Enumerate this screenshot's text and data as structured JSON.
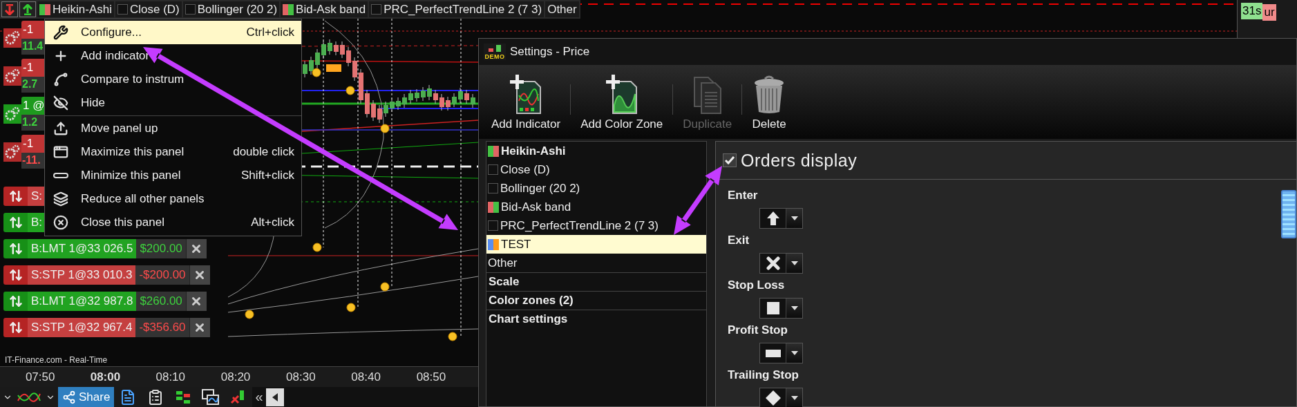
{
  "tabs": [
    {
      "label": "Heikin-Ashi",
      "kind": "indicator",
      "colors": [
        {
          "color": "#44c044"
        },
        {
          "color": "#e06464"
        }
      ]
    },
    {
      "label": "Close (D)",
      "kind": "indicator"
    },
    {
      "label": "Bollinger (20 2)",
      "kind": "indicator"
    },
    {
      "label": "Bid-Ask band",
      "kind": "indicator",
      "colors": [
        {
          "color": "#e06464"
        },
        {
          "color": "#44c044"
        }
      ]
    },
    {
      "label": "PRC_PerfectTrendLine 2 (7 3)",
      "kind": "indicator"
    },
    {
      "label": "Other",
      "kind": "plain"
    }
  ],
  "price_axis": {
    "timer": "31s",
    "badge": "ur"
  },
  "positions": [
    {
      "kind": "sell",
      "label": "-1",
      "value": "11.4",
      "gain": true
    },
    {
      "kind": "sell",
      "label": "-1",
      "value": "2.7",
      "gain": true
    },
    {
      "kind": "buy",
      "label": "1 @",
      "value": "1.2",
      "gain": true
    },
    {
      "kind": "sell",
      "label": "-1",
      "value": "-11.",
      "gain": false
    }
  ],
  "orders": [
    {
      "kind": "sell",
      "label": "S:"
    },
    {
      "kind": "buy",
      "label": "B:"
    },
    {
      "kind": "buy",
      "label": "B:LMT 1@33 026.5",
      "value": "$200.00"
    },
    {
      "kind": "sell",
      "label": "S:STP 1@33 010.3",
      "value": "-$200.00"
    },
    {
      "kind": "buy",
      "label": "B:LMT 1@32 987.8",
      "value": "$260.00"
    },
    {
      "kind": "sell",
      "label": "S:STP 1@32 967.4",
      "value": "-$356.60"
    }
  ],
  "source": "IT-Finance.com - Real-Time",
  "time_axis": [
    {
      "label": "07:50",
      "major": false
    },
    {
      "label": "08:00",
      "major": true
    },
    {
      "label": "08:10",
      "major": false
    },
    {
      "label": "08:20",
      "major": false
    },
    {
      "label": "08:30",
      "major": false
    },
    {
      "label": "08:40",
      "major": false
    },
    {
      "label": "08:50",
      "major": false
    }
  ],
  "bottom_toolbar": {
    "share": "Share",
    "collapse": "«"
  },
  "context_menu": {
    "groups": [
      [
        {
          "label": "Configure...",
          "shortcut": "Ctrl+click",
          "selected": true
        },
        {
          "label": "Add indicator",
          "selected": false
        },
        {
          "label": "Compare to instrum",
          "selected": false
        },
        {
          "label": "Hide",
          "selected": false
        }
      ],
      [
        {
          "label": "Move panel up",
          "selected": false
        },
        {
          "label": "Maximize this panel",
          "shortcut": "double click",
          "selected": false
        },
        {
          "label": "Minimize this panel",
          "shortcut": "Shift+click",
          "selected": false
        },
        {
          "label": "Reduce all other panels",
          "selected": false
        },
        {
          "label": "Close this panel",
          "shortcut": "Alt+click",
          "selected": false
        }
      ]
    ]
  },
  "settings": {
    "logo": "DEMO",
    "title": "Settings - Price",
    "actions": [
      {
        "label": "Add Indicator",
        "disabled": false
      },
      {
        "label": "Add Color Zone",
        "disabled": false
      },
      {
        "label": "Duplicate",
        "disabled": true
      },
      {
        "label": "Delete",
        "disabled": false
      }
    ],
    "tree": [
      {
        "label": "Heikin-Ashi",
        "kind": "main",
        "colors": [
          {
            "color": "#44c044"
          },
          {
            "color": "#e06464"
          }
        ],
        "selected": false
      },
      {
        "label": "Close (D)",
        "kind": "indicator",
        "selected": false
      },
      {
        "label": "Bollinger (20 2)",
        "kind": "indicator",
        "selected": false
      },
      {
        "label": "Bid-Ask band",
        "kind": "indicator",
        "colors": [
          {
            "color": "#e06464"
          },
          {
            "color": "#44c044"
          }
        ],
        "selected": false
      },
      {
        "label": "PRC_PerfectTrendLine 2 (7 3)",
        "kind": "indicator",
        "selected": false
      },
      {
        "label": "TEST",
        "kind": "indicator",
        "colors": [
          {
            "color": "#5b8ef0"
          },
          {
            "color": "#ff9a1a"
          }
        ],
        "selected": true
      },
      {
        "label": "Other",
        "kind": "plain",
        "selected": false
      },
      {
        "label": "Scale",
        "kind": "section",
        "selected": false
      },
      {
        "label": "Color zones (2)",
        "kind": "section",
        "selected": false
      },
      {
        "label": "Chart settings",
        "kind": "section",
        "selected": false
      }
    ],
    "orders_display": {
      "label": "Orders display",
      "checked": true,
      "fields": [
        {
          "label": "Enter"
        },
        {
          "label": "Exit"
        },
        {
          "label": "Stop Loss"
        },
        {
          "label": "Profit Stop"
        },
        {
          "label": "Trailing Stop"
        }
      ]
    }
  }
}
